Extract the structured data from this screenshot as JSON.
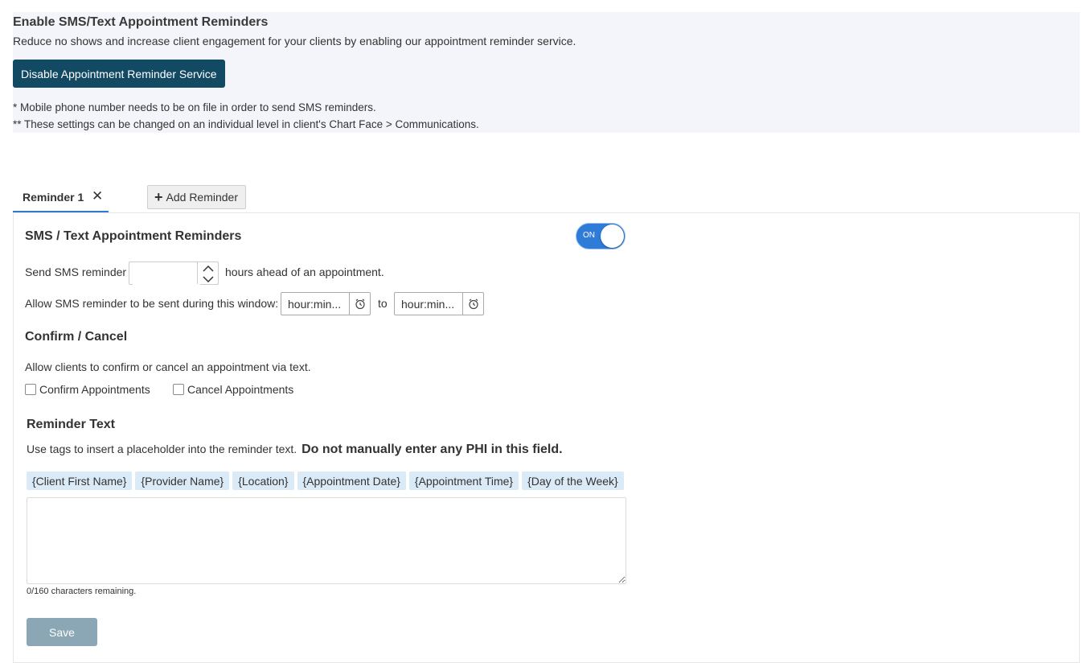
{
  "banner": {
    "title": "Enable SMS/Text Appointment Reminders",
    "description": "Reduce no shows and increase client engagement for your clients by enabling our appointment reminder service.",
    "disable_button": "Disable Appointment Reminder Service",
    "note1": "* Mobile phone number needs to be on file in order to send SMS reminders.",
    "note2": "** These settings can be changed on an individual level in client's Chart Face > Communications."
  },
  "tabs": {
    "active_label": "Reminder 1",
    "close_glyph": "✕",
    "add_label": "Add Reminder",
    "add_glyph": "+"
  },
  "sms": {
    "title": "SMS / Text Appointment Reminders",
    "toggle_label": "ON",
    "send_prefix": "Send SMS reminder",
    "send_suffix": "hours ahead of an appointment.",
    "hours_value": "",
    "window_label": "Allow SMS reminder to be sent during this window:",
    "time_placeholder_start": "hour:min...",
    "time_to": "to",
    "time_placeholder_end": "hour:min..."
  },
  "confirm": {
    "title": "Confirm / Cancel",
    "description": "Allow clients to confirm or cancel an appointment via text.",
    "confirm_label": "Confirm Appointments",
    "cancel_label": "Cancel Appointments"
  },
  "reminder_text": {
    "title": "Reminder Text",
    "description": "Use tags to insert a placeholder into the reminder text.",
    "warning": "Do not manually enter any PHI in this field.",
    "tags": [
      "{Client First Name}",
      "{Provider Name}",
      "{Location}",
      "{Appointment Date}",
      "{Appointment Time}",
      "{Day of the Week}"
    ],
    "value": "",
    "counter": "0/160 characters remaining.",
    "save_label": "Save"
  },
  "colors": {
    "primary_dark": "#124a63",
    "toggle_on": "#2f7bd8",
    "tab_underline": "#2f7bc8",
    "tag_bg": "#dbeaf7",
    "save_disabled": "#8ba6b5"
  }
}
